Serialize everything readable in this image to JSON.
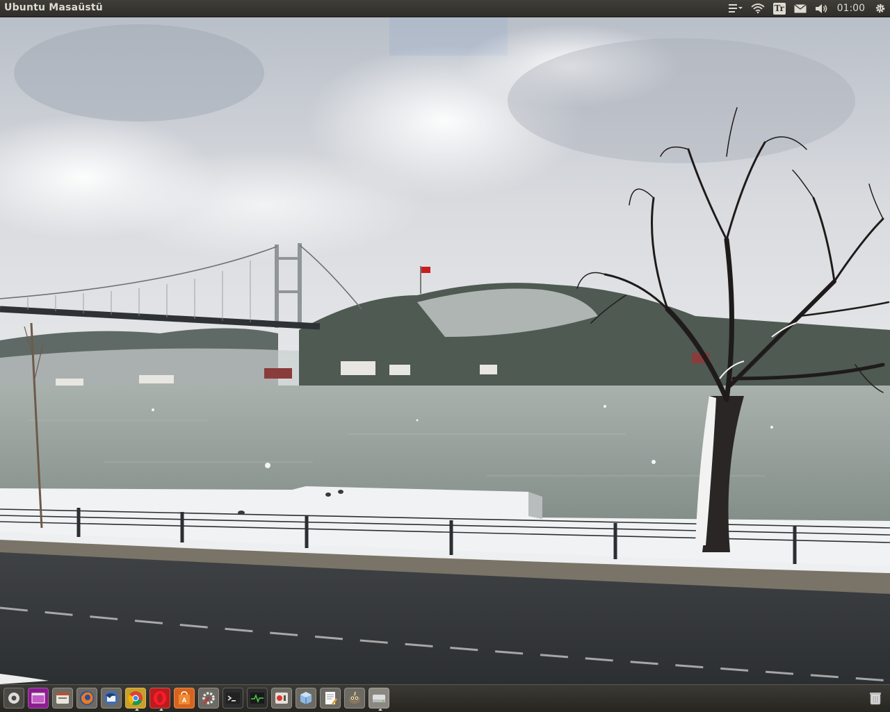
{
  "top_panel": {
    "title": "Ubuntu Masaüstü",
    "keyboard_layout": "Tr",
    "clock": "01:00",
    "indicators": [
      "menu-icon",
      "wifi-icon",
      "keyboard-layout-badge",
      "mail-icon",
      "volume-icon",
      "clock",
      "gear-icon"
    ]
  },
  "dock": {
    "items": [
      {
        "name": "dash-home-icon",
        "running": false
      },
      {
        "name": "workspace-switcher-icon",
        "running": false
      },
      {
        "name": "files-icon",
        "running": false
      },
      {
        "name": "firefox-icon",
        "running": false
      },
      {
        "name": "thunderbird-icon",
        "running": false
      },
      {
        "name": "chrome-icon",
        "running": true
      },
      {
        "name": "opera-icon",
        "running": true
      },
      {
        "name": "software-center-icon",
        "running": false
      },
      {
        "name": "system-settings-icon",
        "running": false
      },
      {
        "name": "terminal-icon",
        "running": false
      },
      {
        "name": "system-monitor-icon",
        "running": false
      },
      {
        "name": "recorder-icon",
        "running": false
      },
      {
        "name": "virtualbox-icon",
        "running": false
      },
      {
        "name": "text-editor-icon",
        "running": false
      },
      {
        "name": "gimp-icon",
        "running": false
      },
      {
        "name": "drive-icon",
        "running": true
      },
      {
        "name": "trash-icon",
        "running": false
      }
    ]
  },
  "colors": {
    "panel_bg": "#3c3b37",
    "panel_text": "#dfdbd2",
    "dock_bg": "#2f2e2a"
  }
}
